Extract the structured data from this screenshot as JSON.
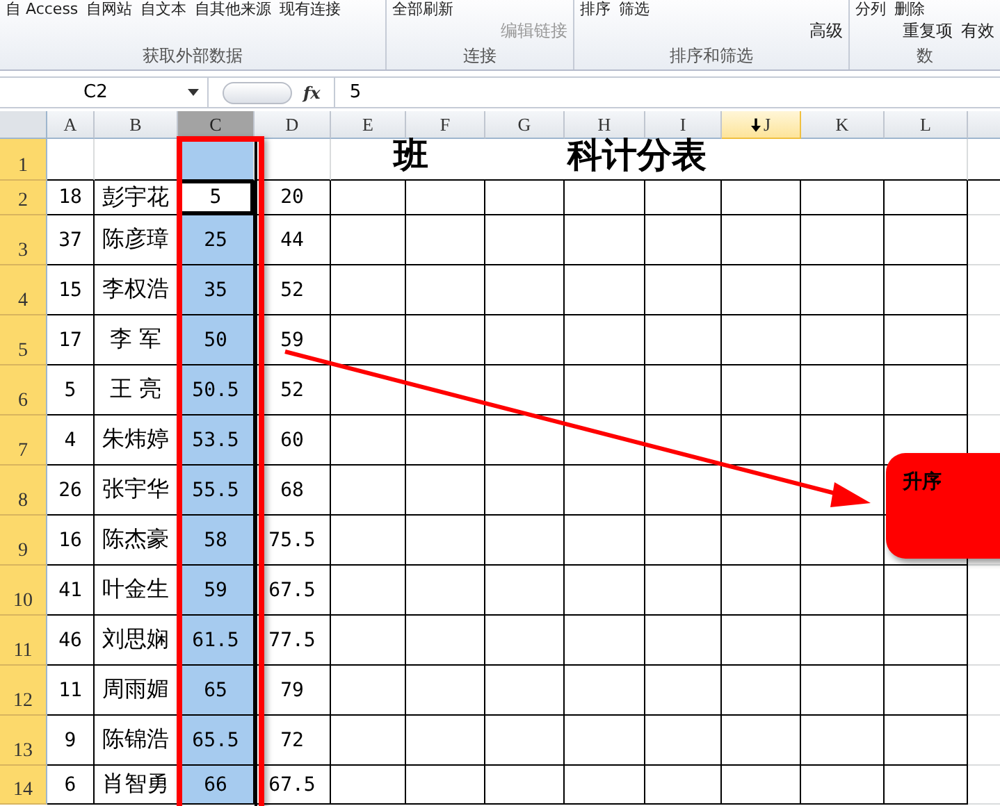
{
  "ribbon": {
    "groups": [
      {
        "label": "获取外部数据",
        "items": [
          {
            "text": "自 Access",
            "kind": "large"
          },
          {
            "text": "自网站",
            "kind": "large"
          },
          {
            "text": "自文本",
            "kind": "large"
          },
          {
            "text": "自其他来源",
            "kind": "large"
          },
          {
            "text": "现有连接",
            "kind": "large"
          }
        ]
      },
      {
        "label": "连接",
        "items": [
          {
            "text": "全部刷新",
            "kind": "large"
          },
          {
            "text": "编辑链接",
            "kind": "small",
            "disabled": true
          }
        ]
      },
      {
        "label": "排序和筛选",
        "items": [
          {
            "text": "排序",
            "kind": "large"
          },
          {
            "text": "筛选",
            "kind": "large"
          },
          {
            "text": "高级",
            "kind": "small",
            "disabled": false
          }
        ]
      },
      {
        "label": "数",
        "items": [
          {
            "text": "分列",
            "kind": "large"
          },
          {
            "text": "删除",
            "kind": "large"
          },
          {
            "text": "重复项",
            "kind": "small",
            "disabled": false
          },
          {
            "text": "有效",
            "kind": "small",
            "disabled": false
          }
        ]
      }
    ]
  },
  "formula_bar": {
    "name_box": "C2",
    "fx": "fx",
    "value": "5"
  },
  "columns": [
    {
      "label": "A",
      "selected": false,
      "hovered": false
    },
    {
      "label": "B",
      "selected": false,
      "hovered": false
    },
    {
      "label": "C",
      "selected": true,
      "hovered": false
    },
    {
      "label": "D",
      "selected": false,
      "hovered": false
    },
    {
      "label": "E",
      "selected": false,
      "hovered": false
    },
    {
      "label": "F",
      "selected": false,
      "hovered": false
    },
    {
      "label": "G",
      "selected": false,
      "hovered": false
    },
    {
      "label": "H",
      "selected": false,
      "hovered": false
    },
    {
      "label": "I",
      "selected": false,
      "hovered": false
    },
    {
      "label": "J",
      "selected": false,
      "hovered": true
    },
    {
      "label": "K",
      "selected": false,
      "hovered": false
    },
    {
      "label": "L",
      "selected": false,
      "hovered": false
    }
  ],
  "title": {
    "part_1": "班",
    "part_2": "科计分表"
  },
  "rows": [
    {
      "number": "1",
      "selected": true
    },
    {
      "number": "2",
      "selected": true,
      "active": true,
      "cells": [
        "18",
        "彭宇花",
        "5",
        "20"
      ]
    },
    {
      "number": "3",
      "selected": true,
      "active": false,
      "cells": [
        "37",
        "陈彦璋",
        "25",
        "44"
      ]
    },
    {
      "number": "4",
      "selected": true,
      "active": false,
      "cells": [
        "15",
        "李权浩",
        "35",
        "52"
      ]
    },
    {
      "number": "5",
      "selected": true,
      "active": false,
      "cells": [
        "17",
        "李 军",
        "50",
        "59"
      ]
    },
    {
      "number": "6",
      "selected": true,
      "active": false,
      "cells": [
        "5",
        "王 亮",
        "50.5",
        "52"
      ]
    },
    {
      "number": "7",
      "selected": true,
      "active": false,
      "cells": [
        "4",
        "朱炜婷",
        "53.5",
        "60"
      ]
    },
    {
      "number": "8",
      "selected": true,
      "active": false,
      "cells": [
        "26",
        "张宇华",
        "55.5",
        "68"
      ]
    },
    {
      "number": "9",
      "selected": true,
      "active": false,
      "cells": [
        "16",
        "陈杰豪",
        "58",
        "75.5"
      ]
    },
    {
      "number": "10",
      "selected": true,
      "active": false,
      "cells": [
        "41",
        "叶金生",
        "59",
        "67.5"
      ]
    },
    {
      "number": "11",
      "selected": true,
      "active": false,
      "cells": [
        "46",
        "刘思娴",
        "61.5",
        "77.5"
      ]
    },
    {
      "number": "12",
      "selected": true,
      "active": false,
      "cells": [
        "11",
        "周雨媚",
        "65",
        "79"
      ]
    },
    {
      "number": "13",
      "selected": true,
      "active": false,
      "cells": [
        "9",
        "陈锦浩",
        "65.5",
        "72"
      ]
    },
    {
      "number": "14",
      "selected": true,
      "active": false,
      "cells": [
        "6",
        "肖智勇",
        "66",
        "67.5"
      ]
    }
  ],
  "callout": {
    "text": "升序"
  }
}
